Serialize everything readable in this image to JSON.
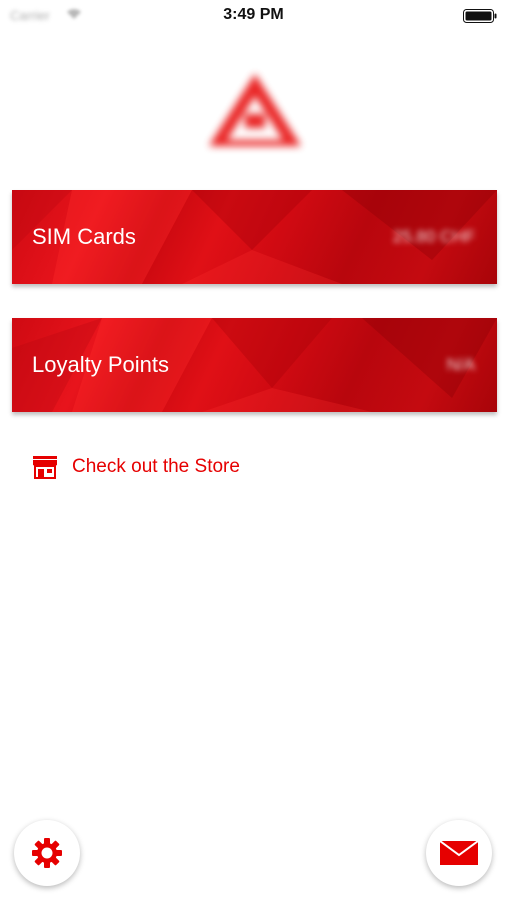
{
  "status_bar": {
    "carrier": "Carrier",
    "time": "3:49 PM"
  },
  "cards": [
    {
      "label": "SIM Cards",
      "value": "25.80 CHF"
    },
    {
      "label": "Loyalty Points",
      "value": "N/A"
    }
  ],
  "store_link": {
    "label": "Check out the Store"
  },
  "icons": {
    "logo": "brand-logo",
    "store": "store-icon",
    "settings": "gear-icon",
    "mail": "mail-icon"
  },
  "colors": {
    "brand_red": "#e60000",
    "card_red": "#cf0a12"
  }
}
